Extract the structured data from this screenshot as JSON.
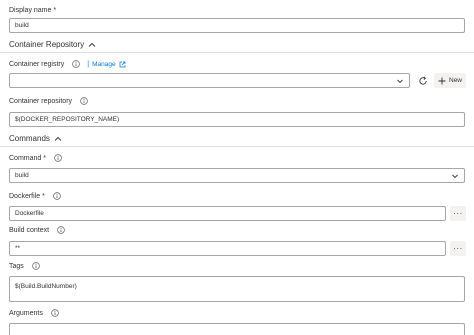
{
  "display_name": {
    "label": "Display name *",
    "value": "build"
  },
  "container_repository_section": {
    "title": "Container Repository"
  },
  "container_registry": {
    "label": "Container registry",
    "manage_link": "Manage",
    "value": "",
    "new_label": "New"
  },
  "container_repository": {
    "label": "Container repository",
    "value": "$(DOCKER_REPOSITORY_NAME)"
  },
  "commands_section": {
    "title": "Commands"
  },
  "command": {
    "label": "Command *",
    "value": "build"
  },
  "dockerfile": {
    "label": "Dockerfile *",
    "value": "Dockerfile"
  },
  "build_context": {
    "label": "Build context",
    "value": "**"
  },
  "tags": {
    "label": "Tags",
    "value": "$(Build.BuildNumber)"
  },
  "arguments": {
    "label": "Arguments",
    "value": ""
  },
  "colors": {
    "link": "#0078d4",
    "border": "#a6a6a6",
    "divider": "#e1dfdd",
    "button_bg": "#f3f2f1"
  }
}
